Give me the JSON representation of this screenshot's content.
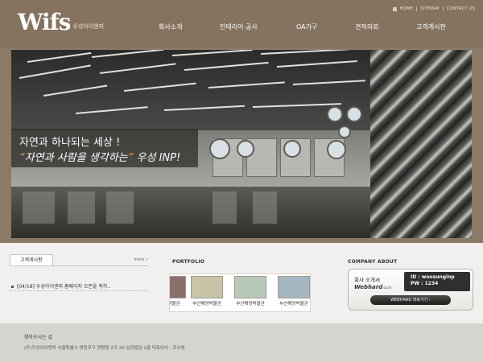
{
  "header": {
    "logo_mark": "Wifs",
    "logo_sub": "우성아이엔피",
    "util_links": [
      "HOME",
      "SITEMAP",
      "CONTACT US"
    ],
    "nav": [
      "회사소개",
      "인테리어 공사",
      "OA가구",
      "견적의뢰",
      "고객게시판"
    ]
  },
  "visual": {
    "slogan_line1": "자연과 하나되는 세상 !",
    "slogan_quote_open": "“",
    "slogan_quote_text": "자연과 사람을 생각하는",
    "slogan_quote_close": "”",
    "slogan_brand": "우성 INP!"
  },
  "notice": {
    "tab_label": "고객게시판",
    "more": "more »",
    "items": [
      "[04/18] 우성아이엔피 홈페이지 오픈을 축하.."
    ]
  },
  "portfolio": {
    "title": "PORTFOLIO",
    "items": [
      {
        "label": "해양박물관",
        "color": "#8a6f6a"
      },
      {
        "label": "부산해양박물관",
        "color": "#c9c4a6"
      },
      {
        "label": "부산해양박물관",
        "color": "#b9c9b8"
      },
      {
        "label": "부산해양박물관",
        "color": "#a6b7c4"
      }
    ]
  },
  "company": {
    "title": "COMPANY ABOUT",
    "intro": "회사 소개서",
    "webhard_logo": "Webhard",
    "webhard_suffix": ".co.kr",
    "id_line": "ID : woosunginp",
    "pw_line": "PW : 1234",
    "button_label": "WEBHARD 바로가기 ›"
  },
  "footer": {
    "title": "찾아오시는 길",
    "info": "(주)우성아이엔피    서울특별시 영등포구 양평동 2가 20 삼광빌딩 2층    대표이사 : 조수영"
  }
}
